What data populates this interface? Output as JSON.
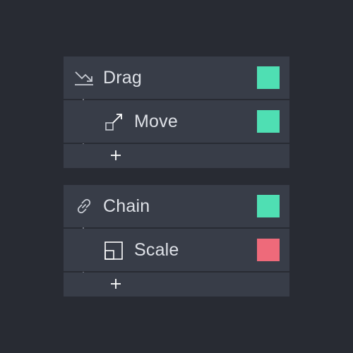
{
  "groups": [
    {
      "header": {
        "label": "Drag",
        "icon": "trending-down-icon",
        "color": "#4fdfb3"
      },
      "children": [
        {
          "label": "Move",
          "icon": "move-diagonal-icon",
          "color": "#4fdfb3"
        }
      ],
      "add_icon": "plus-icon"
    },
    {
      "header": {
        "label": "Chain",
        "icon": "link-icon",
        "color": "#4fdfb3"
      },
      "children": [
        {
          "label": "Scale",
          "icon": "scale-icon",
          "color": "#ee6a7a"
        }
      ],
      "add_icon": "plus-icon"
    }
  ]
}
